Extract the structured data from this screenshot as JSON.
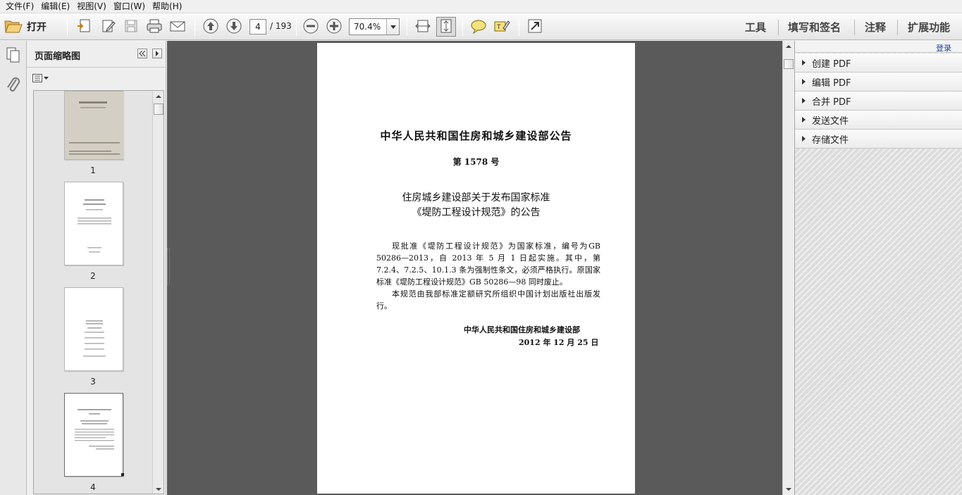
{
  "menu": [
    "文件(F)",
    "编辑(E)",
    "视图(V)",
    "窗口(W)",
    "帮助(H)"
  ],
  "toolbar": {
    "open_label": "打开",
    "current_page": "4",
    "total_pages": "/ 193",
    "zoom": "70.4%",
    "right_tabs": [
      "工具",
      "填写和签名",
      "注释",
      "扩展功能"
    ]
  },
  "thumbnails_panel": {
    "title": "页面缩略图",
    "pages": [
      "1",
      "2",
      "3",
      "4"
    ]
  },
  "document": {
    "title": "中华人民共和国住房和城乡建设部公告",
    "number": "第 1578 号",
    "subtitle_line1": "住房城乡建设部关于发布国家标准",
    "subtitle_line2": "《堤防工程设计规范》的公告",
    "paragraph1": "现批准《堤防工程设计规范》为国家标准，编号为GB 50286—2013，自 2013 年 5 月 1 日起实施。其中，第 7.2.4、7.2.5、10.1.3 条为强制性条文，必须严格执行。原国家标准《堤防工程设计规范》GB 50286—98 同时废止。",
    "paragraph2": "本规范由我部标准定额研究所组织中国计划出版社出版发行。",
    "issuer": "中华人民共和国住房和城乡建设部",
    "date": "2012 年 12 月 25 日"
  },
  "right_panel": {
    "login": "登录",
    "items": [
      "创建 PDF",
      "编辑 PDF",
      "合并 PDF",
      "发送文件",
      "存储文件"
    ]
  },
  "colors": {
    "doc_background": "#5a5a5a",
    "login_link": "#1a3f9a"
  }
}
